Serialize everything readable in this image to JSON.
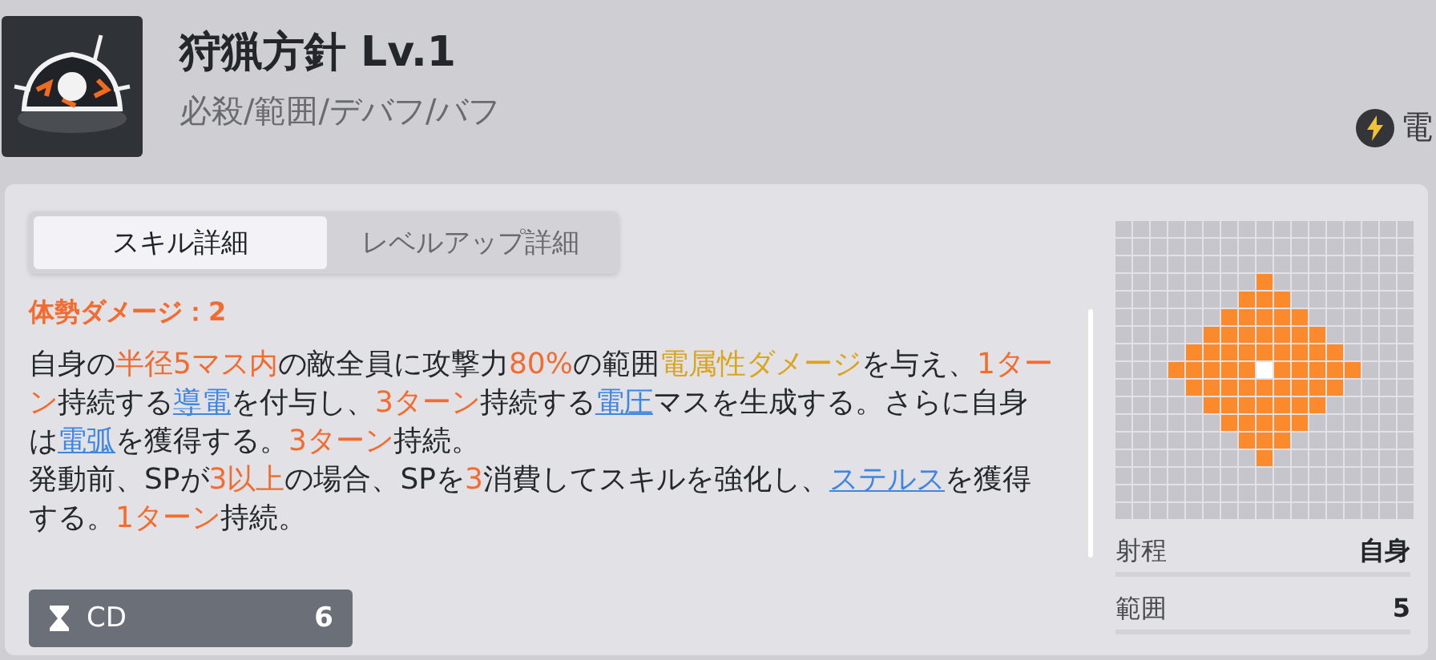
{
  "skill": {
    "title": "狩猟方針 Lv.1",
    "tags": "必殺/範囲/デバフ/バフ",
    "element": "電"
  },
  "tabs": [
    {
      "label": "スキル詳細",
      "selected": true
    },
    {
      "label": "レベルアップ詳細",
      "selected": false
    }
  ],
  "stance_damage": "体勢ダメージ：2",
  "description": [
    [
      {
        "kind": "plain",
        "text": "自身の"
      },
      {
        "kind": "highlight",
        "text": "半径5マス内"
      },
      {
        "kind": "plain",
        "text": "の敵全員に攻撃力"
      },
      {
        "kind": "highlight",
        "text": "80%"
      },
      {
        "kind": "plain",
        "text": "の範囲"
      },
      {
        "kind": "element",
        "text": "電属性ダメージ"
      },
      {
        "kind": "plain",
        "text": "を与え、"
      },
      {
        "kind": "highlight",
        "text": "1ターン"
      },
      {
        "kind": "plain",
        "text": "持続する"
      },
      {
        "kind": "link",
        "text": "導電"
      },
      {
        "kind": "plain",
        "text": "を付与し、"
      },
      {
        "kind": "highlight",
        "text": "3ターン"
      },
      {
        "kind": "plain",
        "text": "持続する"
      },
      {
        "kind": "link",
        "text": "電圧"
      },
      {
        "kind": "plain",
        "text": "マスを生成する。さらに自身は"
      },
      {
        "kind": "link",
        "text": "電弧"
      },
      {
        "kind": "plain",
        "text": "を獲得する。"
      },
      {
        "kind": "highlight",
        "text": "3ターン"
      },
      {
        "kind": "plain",
        "text": "持続。"
      }
    ],
    [
      {
        "kind": "plain",
        "text": "発動前、SPが"
      },
      {
        "kind": "highlight",
        "text": "3以上"
      },
      {
        "kind": "plain",
        "text": "の場合、SPを"
      },
      {
        "kind": "highlight",
        "text": "3"
      },
      {
        "kind": "plain",
        "text": "消費してスキルを強化し、"
      },
      {
        "kind": "link",
        "text": "ステルス"
      },
      {
        "kind": "plain",
        "text": "を獲得する。"
      },
      {
        "kind": "highlight",
        "text": "1ターン"
      },
      {
        "kind": "plain",
        "text": "持続。"
      }
    ]
  ],
  "cooldown": {
    "label": "CD",
    "value": "6"
  },
  "range_grid": [
    {
      "hit": [
        false,
        false,
        false,
        false,
        false,
        false,
        false,
        false,
        false,
        false,
        false,
        false,
        false,
        false,
        false,
        false,
        false
      ]
    },
    {
      "hit": [
        false,
        false,
        false,
        false,
        false,
        false,
        false,
        false,
        false,
        false,
        false,
        false,
        false,
        false,
        false,
        false,
        false
      ]
    },
    {
      "hit": [
        false,
        false,
        false,
        false,
        false,
        false,
        false,
        false,
        false,
        false,
        false,
        false,
        false,
        false,
        false,
        false,
        false
      ]
    },
    {
      "hit": [
        false,
        false,
        false,
        false,
        false,
        false,
        false,
        false,
        true,
        false,
        false,
        false,
        false,
        false,
        false,
        false,
        false
      ]
    },
    {
      "hit": [
        false,
        false,
        false,
        false,
        false,
        false,
        false,
        true,
        true,
        true,
        false,
        false,
        false,
        false,
        false,
        false,
        false
      ]
    },
    {
      "hit": [
        false,
        false,
        false,
        false,
        false,
        false,
        true,
        true,
        true,
        true,
        true,
        false,
        false,
        false,
        false,
        false,
        false
      ]
    },
    {
      "hit": [
        false,
        false,
        false,
        false,
        false,
        true,
        true,
        true,
        true,
        true,
        true,
        true,
        false,
        false,
        false,
        false,
        false
      ]
    },
    {
      "hit": [
        false,
        false,
        false,
        false,
        true,
        true,
        true,
        true,
        true,
        true,
        true,
        true,
        true,
        false,
        false,
        false,
        false
      ]
    },
    {
      "hit": [
        false,
        false,
        false,
        true,
        true,
        true,
        true,
        true,
        false,
        true,
        true,
        true,
        true,
        true,
        false,
        false,
        false
      ],
      "self": [
        false,
        false,
        false,
        false,
        false,
        false,
        false,
        false,
        true,
        false,
        false,
        false,
        false,
        false,
        false,
        false,
        false
      ]
    },
    {
      "hit": [
        false,
        false,
        false,
        false,
        true,
        true,
        true,
        true,
        true,
        true,
        true,
        true,
        true,
        false,
        false,
        false,
        false
      ]
    },
    {
      "hit": [
        false,
        false,
        false,
        false,
        false,
        true,
        true,
        true,
        true,
        true,
        true,
        true,
        false,
        false,
        false,
        false,
        false
      ]
    },
    {
      "hit": [
        false,
        false,
        false,
        false,
        false,
        false,
        true,
        true,
        true,
        true,
        true,
        false,
        false,
        false,
        false,
        false,
        false
      ]
    },
    {
      "hit": [
        false,
        false,
        false,
        false,
        false,
        false,
        false,
        true,
        true,
        true,
        false,
        false,
        false,
        false,
        false,
        false,
        false
      ]
    },
    {
      "hit": [
        false,
        false,
        false,
        false,
        false,
        false,
        false,
        false,
        true,
        false,
        false,
        false,
        false,
        false,
        false,
        false,
        false
      ]
    },
    {
      "hit": [
        false,
        false,
        false,
        false,
        false,
        false,
        false,
        false,
        false,
        false,
        false,
        false,
        false,
        false,
        false,
        false,
        false
      ]
    },
    {
      "hit": [
        false,
        false,
        false,
        false,
        false,
        false,
        false,
        false,
        false,
        false,
        false,
        false,
        false,
        false,
        false,
        false,
        false
      ]
    },
    {
      "hit": [
        false,
        false,
        false,
        false,
        false,
        false,
        false,
        false,
        false,
        false,
        false,
        false,
        false,
        false,
        false,
        false,
        false
      ]
    }
  ],
  "stats": [
    {
      "label": "射程",
      "value": "自身"
    },
    {
      "label": "範囲",
      "value": "5"
    }
  ]
}
